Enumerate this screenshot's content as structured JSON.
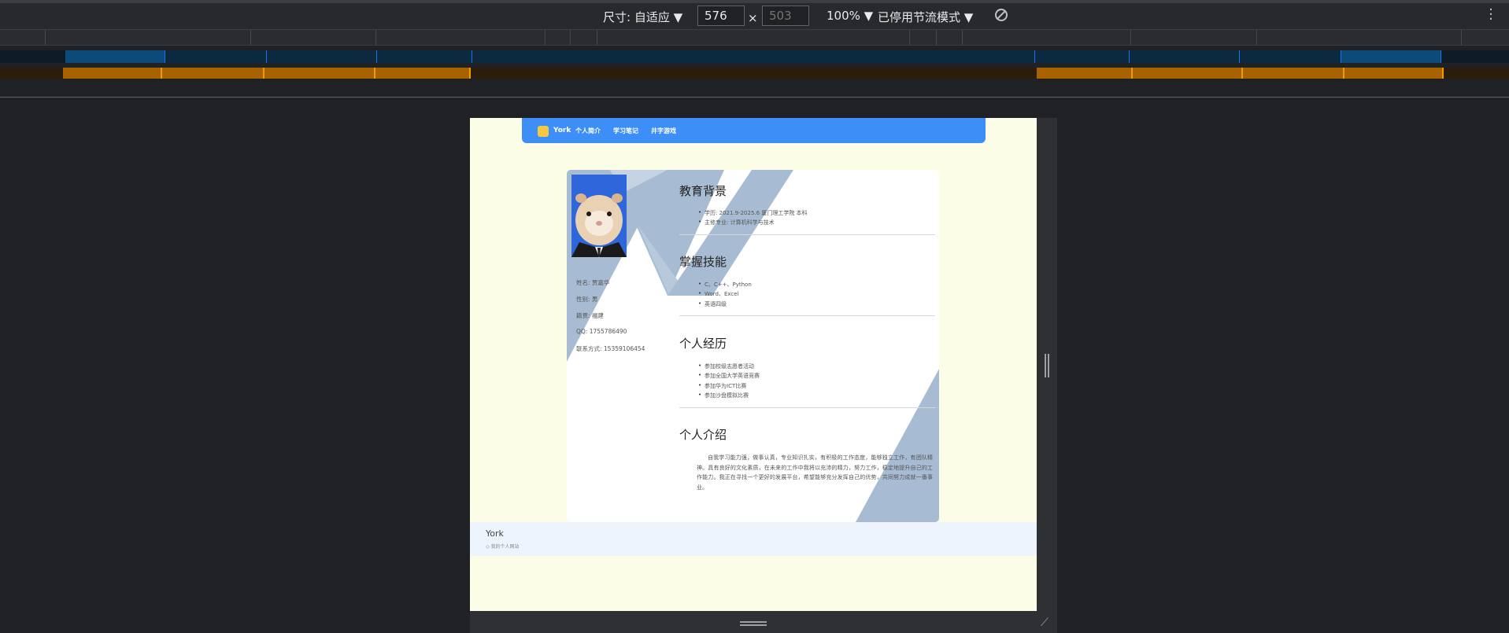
{
  "devtools": {
    "dimensions_label": "尺寸: 自适应 ▼",
    "width_value": "576",
    "height_placeholder": "503",
    "times": "×",
    "zoom": "100% ▼",
    "throttle": "已停用节流模式 ▼"
  },
  "site": {
    "nav": {
      "brand": "York",
      "links": [
        "个人简介",
        "学习笔记",
        "井字游戏"
      ]
    },
    "profile": {
      "name": "姓名: 贾嘉华",
      "gender": "性别: 男",
      "origin": "籍贯: 福建",
      "qq": "QQ: 1755786490",
      "contact": "联系方式: 15359106454"
    },
    "sections": {
      "education": {
        "title": "教育背景",
        "items": [
          "学历: 2021.9-2025.6 厦门理工学院 本科",
          "主修专业: 计算机科学与技术"
        ]
      },
      "skills": {
        "title": "掌握技能",
        "items": [
          "C、C++、Python",
          "Word、Excel",
          "英语四级"
        ]
      },
      "experience": {
        "title": "个人经历",
        "items": [
          "参加校级志愿者活动",
          "参加全国大学英语竞赛",
          "参加华为ICT比赛",
          "参加沙盘模拟比赛"
        ]
      },
      "intro": {
        "title": "个人介绍",
        "text": "自我学习能力强，做事认真，专业知识扎实，有积极的工作态度，能够独立工作，有团队精神。具有良好的文化素质，在未来的工作中我将以充沛的精力，努力工作，稳定地提升自己的工作能力。我正在寻找一个更好的发展平台，希望能够充分发挥自己的优势，共同努力成就一番事业。"
      }
    },
    "footer": {
      "name": "York",
      "sub": "◇  我的个人网站"
    }
  },
  "colors": {
    "nav": "#3d8ef7",
    "page_bg": "#fcfde6",
    "deco": "#a7bcd2"
  }
}
